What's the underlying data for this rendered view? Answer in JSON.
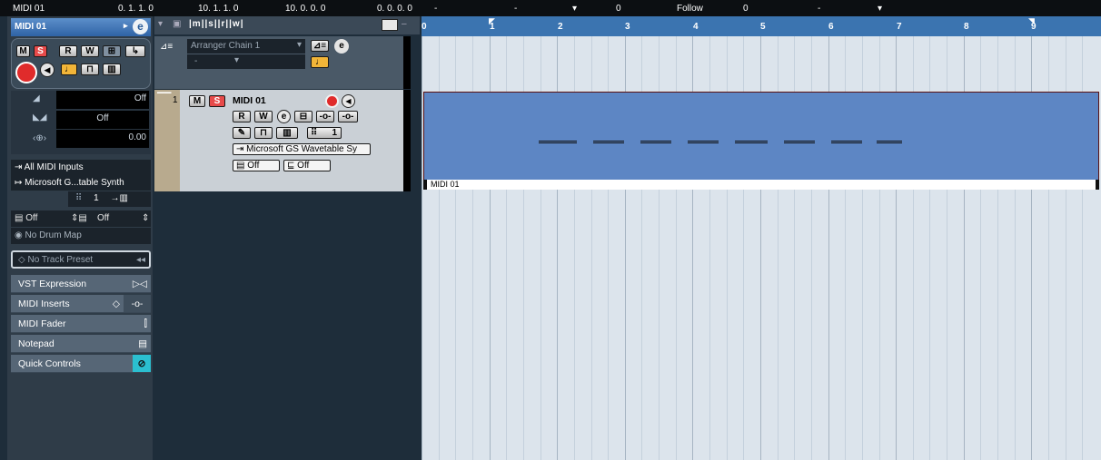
{
  "transport_bar": {
    "track_name": "MIDI 01",
    "start": "0. 1. 1.  0",
    "end": "10. 1. 1.  0",
    "length": "10. 0. 0.  0",
    "offset": "0. 0. 0.  0",
    "mute_value": "-",
    "zoom_value": "-",
    "transpose_value": "0",
    "follow_label": "Follow",
    "follow_value": "0",
    "last_value": "-"
  },
  "inspector": {
    "title": "MIDI 01",
    "mute": "M",
    "solo": "S",
    "read": "R",
    "write": "W",
    "volume_value": "Off",
    "pan_value": "Off",
    "delay_value": "0.00",
    "input": "All MIDI Inputs",
    "output": "Microsoft G...table Synth",
    "channel": "1",
    "bank_value": "Off",
    "program_value": "Off",
    "drum_map": "No Drum Map",
    "track_preset": "No Track Preset",
    "sections": [
      "VST Expression",
      "MIDI Inserts",
      "MIDI Fader",
      "Notepad",
      "Quick Controls"
    ]
  },
  "arranger": {
    "chain": "Arranger Chain 1",
    "value": "-"
  },
  "track": {
    "number": "1",
    "name": "MIDI 01",
    "mute": "M",
    "solo": "S",
    "read": "R",
    "write": "W",
    "channel": "1",
    "output": "Microsoft GS Wavetable Sy",
    "bank": "Off",
    "program": "Off"
  },
  "ruler": {
    "bars": [
      "0",
      "1",
      "2",
      "3",
      "4",
      "5",
      "6",
      "7",
      "8",
      "9"
    ]
  },
  "part": {
    "name": "MIDI 01"
  },
  "colors": {
    "part_fill": "#5d86c4",
    "ruler": "#3b74b0",
    "record": "#e02b2b",
    "solo": "#e74a4a",
    "quick_controls": "#2bbfd0"
  }
}
